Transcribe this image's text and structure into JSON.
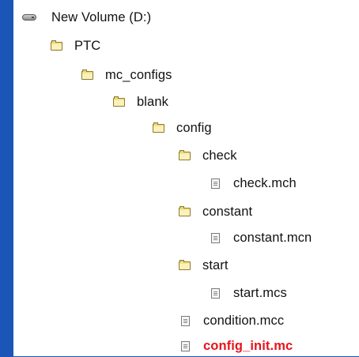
{
  "tree": {
    "drive": {
      "label": "New Volume (D:)",
      "icon": "drive-icon"
    },
    "ptc": {
      "label": "PTC",
      "icon": "folder-icon"
    },
    "mc_configs": {
      "label": "mc_configs",
      "icon": "folder-icon"
    },
    "blank": {
      "label": "blank",
      "icon": "folder-icon"
    },
    "config": {
      "label": "config",
      "icon": "folder-icon"
    },
    "check": {
      "label": "check",
      "icon": "folder-icon"
    },
    "check_file": {
      "label": "check.mch",
      "icon": "file-icon"
    },
    "constant": {
      "label": "constant",
      "icon": "folder-icon"
    },
    "constant_file": {
      "label": "constant.mcn",
      "icon": "file-icon"
    },
    "start": {
      "label": "start",
      "icon": "folder-icon"
    },
    "start_file": {
      "label": "start.mcs",
      "icon": "file-icon"
    },
    "condition_file": {
      "label": "condition.mcc",
      "icon": "file-icon"
    },
    "config_init_file": {
      "label": "config_init.mc",
      "icon": "file-icon",
      "highlight_color": "#e8141c"
    }
  },
  "colors": {
    "background": "#1c55b8",
    "panel": "#ffffff",
    "text": "#111111",
    "highlight": "#e8141c"
  }
}
